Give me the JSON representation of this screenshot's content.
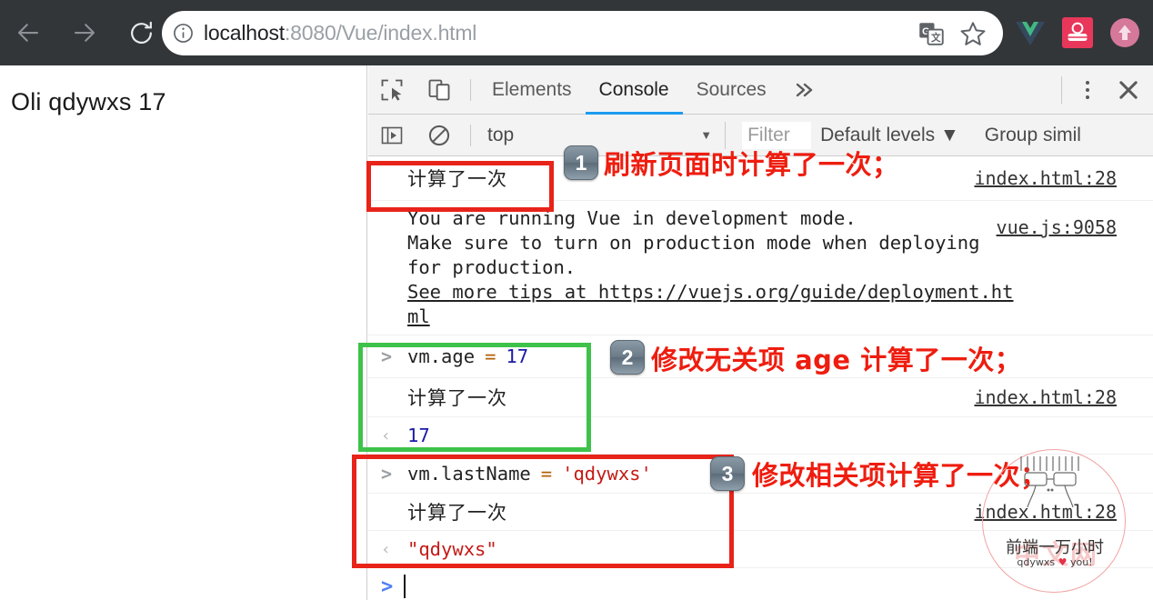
{
  "browser": {
    "nav": {
      "back_icon": "arrow-left-icon",
      "forward_icon": "arrow-right-icon",
      "reload_icon": "reload-icon"
    },
    "omnibox": {
      "info_icon": "info-circle-icon",
      "url_host": "localhost",
      "url_path": ":8080/Vue/index.html",
      "translate_icon": "google-translate-icon",
      "bookmark_icon": "star-icon"
    },
    "extensions": [
      {
        "name": "vue-devtools-icon",
        "color": "#41b883"
      },
      {
        "name": "pink-extension-icon",
        "color": "#e8375a"
      },
      {
        "name": "upload-arrow-icon",
        "color": "#d6789a"
      }
    ]
  },
  "page": {
    "heading": "Oli qdywxs 17"
  },
  "devtools": {
    "tools": {
      "inspect_icon": "inspect-element-icon",
      "device_icon": "device-toolbar-icon"
    },
    "tabs": [
      {
        "label": "Elements",
        "active": false
      },
      {
        "label": "Console",
        "active": true
      },
      {
        "label": "Sources",
        "active": false
      }
    ],
    "more_tabs_icon": "chevron-double-right-icon",
    "kebab_icon": "more-options-icon",
    "close_icon": "close-icon",
    "console_toolbar": {
      "sidebar_icon": "console-sidebar-icon",
      "clear_icon": "clear-console-icon",
      "context": "top",
      "context_caret": "▼",
      "filter_placeholder": "Filter",
      "levels": "Default levels",
      "levels_caret": "▼",
      "group_similar": "Group simil"
    },
    "console_rows": [
      {
        "type": "log",
        "gutter": "",
        "text": "计算了一次",
        "source": "index.html:28"
      },
      {
        "type": "warning",
        "lines": [
          "You are running Vue in development mode.",
          "Make sure to turn on production mode when deploying",
          "for production.",
          "See more tips at https://vuejs.org/guide/deployment.ht",
          "ml"
        ],
        "link": "https://vuejs.org/guide/deployment.html",
        "source": "vue.js:9058"
      },
      {
        "type": "input",
        "gutter": ">",
        "expr_name": "vm.age",
        "expr_op": "=",
        "expr_value": "17",
        "value_kind": "number"
      },
      {
        "type": "log",
        "gutter": "",
        "text": "计算了一次",
        "source": "index.html:28"
      },
      {
        "type": "output",
        "gutter": "‹",
        "value": "17",
        "value_kind": "number"
      },
      {
        "type": "input",
        "gutter": ">",
        "expr_name": "vm.lastName",
        "expr_op": "=",
        "expr_value": "'qdywxs'",
        "value_kind": "string"
      },
      {
        "type": "log",
        "gutter": "",
        "text": "计算了一次",
        "source": "index.html:28"
      },
      {
        "type": "output",
        "gutter": "‹",
        "value": "\"qdywxs\"",
        "value_kind": "string"
      }
    ],
    "prompt": {
      "caret": "&gt;",
      "value": ""
    }
  },
  "annotations": [
    {
      "number": "1",
      "text": "刷新页面时计算了一次；",
      "box_color": "#e8231a"
    },
    {
      "number": "2",
      "text": "修改无关项 age 计算了一次；",
      "box_color": "#3fc24a"
    },
    {
      "number": "3",
      "text": "修改相关项计算了一次；",
      "box_color": "#e8231a"
    }
  ],
  "watermark": {
    "title": "前端一万小时",
    "subtitle_prefix": "qdywxs ",
    "heart": "♥",
    "subtitle_suffix": " you!",
    "faded_text": "中文网"
  },
  "colors": {
    "accent_tab": "#1a9bf0",
    "annotation_red": "#ee1d0f",
    "highlight_green": "#3fc24a",
    "highlight_red": "#e8231a",
    "string_token": "#c41a16",
    "number_token": "#1a1aa6",
    "operator_token": "#b45f06"
  }
}
